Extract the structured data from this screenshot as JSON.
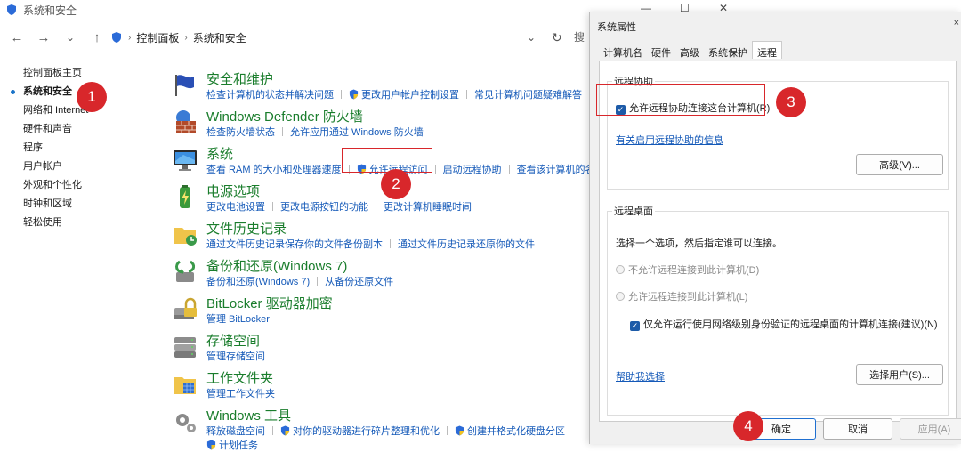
{
  "window": {
    "title": "系统和安全"
  },
  "address": {
    "crumbs": [
      "控制面板",
      "系统和安全"
    ],
    "search_text": "搜"
  },
  "sidebar": {
    "items": [
      {
        "label": "控制面板主页",
        "active": false
      },
      {
        "label": "系统和安全",
        "active": true
      },
      {
        "label": "网络和 Internet",
        "active": false
      },
      {
        "label": "硬件和声音",
        "active": false
      },
      {
        "label": "程序",
        "active": false
      },
      {
        "label": "用户帐户",
        "active": false
      },
      {
        "label": "外观和个性化",
        "active": false
      },
      {
        "label": "时钟和区域",
        "active": false
      },
      {
        "label": "轻松使用",
        "active": false
      }
    ]
  },
  "categories": [
    {
      "title": "安全和维护",
      "icon": "flag-icon",
      "links": [
        "检查计算机的状态并解决问题",
        "更改用户帐户控制设置",
        "常见计算机问题疑难解答"
      ]
    },
    {
      "title": "Windows Defender 防火墙",
      "icon": "firewall-icon",
      "links": [
        "检查防火墙状态",
        "允许应用通过 Windows 防火墙"
      ]
    },
    {
      "title": "系统",
      "icon": "monitor-icon",
      "links": [
        "查看 RAM 的大小和处理器速度",
        "允许远程访问",
        "启动远程协助",
        "查看该计算机的名"
      ]
    },
    {
      "title": "电源选项",
      "icon": "battery-icon",
      "links": [
        "更改电池设置",
        "更改电源按钮的功能",
        "更改计算机睡眠时间"
      ]
    },
    {
      "title": "文件历史记录",
      "icon": "file-history-icon",
      "links": [
        "通过文件历史记录保存你的文件备份副本",
        "通过文件历史记录还原你的文件"
      ]
    },
    {
      "title": "备份和还原(Windows 7)",
      "icon": "backup-icon",
      "links": [
        "备份和还原(Windows 7)",
        "从备份还原文件"
      ]
    },
    {
      "title": "BitLocker 驱动器加密",
      "icon": "bitlocker-icon",
      "links": [
        "管理 BitLocker"
      ]
    },
    {
      "title": "存储空间",
      "icon": "storage-icon",
      "links": [
        "管理存储空间"
      ]
    },
    {
      "title": "工作文件夹",
      "icon": "work-folder-icon",
      "links": [
        "管理工作文件夹"
      ]
    },
    {
      "title": "Windows 工具",
      "icon": "tools-icon",
      "links": [
        "释放磁盘空间",
        "对你的驱动器进行碎片整理和优化",
        "创建并格式化硬盘分区",
        "计划任务"
      ]
    }
  ],
  "badges": [
    "1",
    "2",
    "3",
    "4"
  ],
  "dialog": {
    "title": "系统属性",
    "close": "×",
    "tabs": [
      "计算机名",
      "硬件",
      "高级",
      "系统保护",
      "远程"
    ],
    "active_tab": "远程",
    "remote_assist": {
      "label": "远程协助",
      "checkbox": "允许远程协助连接这台计算机(R)",
      "info_link": "有关启用远程协助的信息",
      "advanced_button": "高级(V)..."
    },
    "remote_desktop": {
      "label": "远程桌面",
      "instruction": "选择一个选项，然后指定谁可以连接。",
      "option_off": "不允许远程连接到此计算机(D)",
      "option_on": "允许远程连接到此计算机(L)",
      "nla_checkbox": "仅允许运行使用网络级别身份验证的远程桌面的计算机连接(建议)(N)",
      "help_link": "帮助我选择",
      "select_users_button": "选择用户(S)..."
    },
    "ok_button": "确定",
    "cancel_button": "取消",
    "apply_button": "应用(A)"
  },
  "colors": {
    "category_title": "#1a7d2c",
    "link": "#1459b8",
    "badge": "#d8272b",
    "highlight": "#d8272b"
  }
}
